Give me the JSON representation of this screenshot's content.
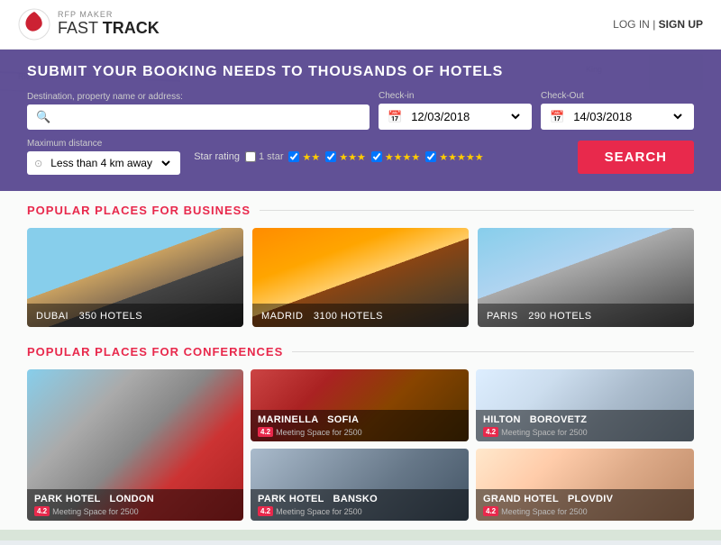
{
  "header": {
    "rfp_label": "RFP MAKER",
    "brand_fast": "FAST",
    "brand_track": "TRACK",
    "nav_login": "LOG IN",
    "nav_separator": " | ",
    "nav_signup": "SIGN UP"
  },
  "search": {
    "title": "SUBMIT YOUR BOOKING NEEDS TO THOUSANDS OF HOTELS",
    "destination_label": "Destination, property name or address:",
    "destination_placeholder": "",
    "checkin_label": "Check-in",
    "checkin_value": "12/03/2018",
    "checkout_label": "Check-Out",
    "checkout_value": "14/03/2018",
    "max_dist_label": "Maximum distance",
    "max_dist_value": "Less than 4 km away",
    "star_label": "Star rating",
    "stars": [
      {
        "label": "1 star",
        "checked": false
      },
      {
        "label": "2 stars",
        "checked": true
      },
      {
        "label": "3 stars",
        "checked": true
      },
      {
        "label": "4 stars",
        "checked": true
      },
      {
        "label": "5 stars",
        "checked": true
      }
    ],
    "search_btn": "SEARCH"
  },
  "business_section": {
    "title": "POPULAR PLACES FOR BUSINESS",
    "cards": [
      {
        "city": "DUBAI",
        "hotels": "350 HOTELS",
        "css_class": "city-dubai"
      },
      {
        "city": "MADRID",
        "hotels": "3100 HOTELS",
        "css_class": "city-madrid"
      },
      {
        "city": "PARIS",
        "hotels": "290 HOTELS",
        "css_class": "city-paris"
      }
    ]
  },
  "conference_section": {
    "title": "POPULAR PLACES FOR  CONFERENCES",
    "cards": [
      {
        "name": "PARK HOTEL",
        "city": "LONDON",
        "meta": "Meeting Space for 2500",
        "css_class": "venue-park-london",
        "large": true
      },
      {
        "name": "MARINELLA",
        "city": "SOFIA",
        "meta": "Meeting Space for 2500",
        "css_class": "venue-marinella",
        "large": false
      },
      {
        "name": "HILTON",
        "city": "BOROVETZ",
        "meta": "Meeting Space for 2500",
        "css_class": "venue-hilton",
        "large": false
      },
      {
        "name": "PARK HOTEL",
        "city": "BANSKO",
        "meta": "Meeting Space for 2500",
        "css_class": "venue-park-bansko",
        "large": false
      },
      {
        "name": "GRAND HOTEL",
        "city": "PLOVDIV",
        "meta": "Meeting Space for 2500",
        "css_class": "venue-grand-plovdiv",
        "large": false
      }
    ]
  }
}
